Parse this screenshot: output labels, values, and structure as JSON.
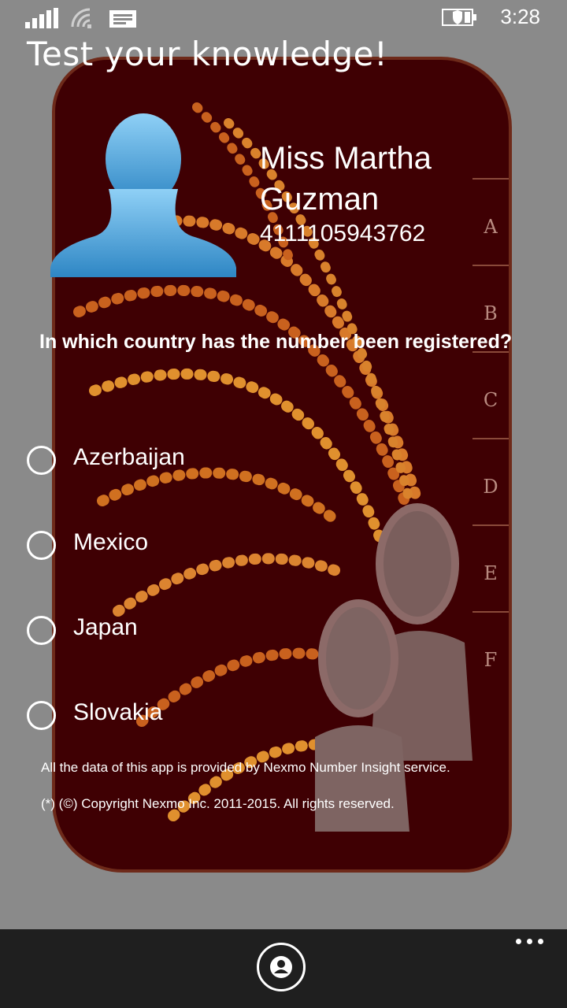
{
  "status_bar": {
    "time": "3:28",
    "icons": [
      "signal-icon",
      "wifi-icon",
      "message-icon",
      "battery-saver-icon"
    ]
  },
  "page": {
    "title": "Test your knowledge!"
  },
  "contact": {
    "name": "Miss Martha Guzman",
    "number": "4111105943762",
    "avatar_icon": "person-silhouette-icon"
  },
  "quiz": {
    "question": "In which country has the number been registered?",
    "options": [
      {
        "label": "Azerbaijan",
        "selected": false
      },
      {
        "label": "Mexico",
        "selected": false
      },
      {
        "label": "Japan",
        "selected": false
      },
      {
        "label": "Slovakia",
        "selected": false
      }
    ]
  },
  "background_tabs": [
    "A",
    "B",
    "C",
    "D",
    "E",
    "F"
  ],
  "footer": {
    "line1": "All the data of this app is provided by Nexmo Number Insight service.",
    "line2": "(*) (©) Copyright Nexmo Inc. 2011-2015. All rights reserved."
  },
  "app_bar": {
    "primary_button_icon": "contact-icon",
    "more_icon": "ellipsis-icon"
  },
  "colors": {
    "background": "#8a8a8a",
    "card": "#3f0003",
    "app_bar": "#1f1f1f",
    "avatar": "#4aa3da",
    "text": "#ffffff"
  }
}
